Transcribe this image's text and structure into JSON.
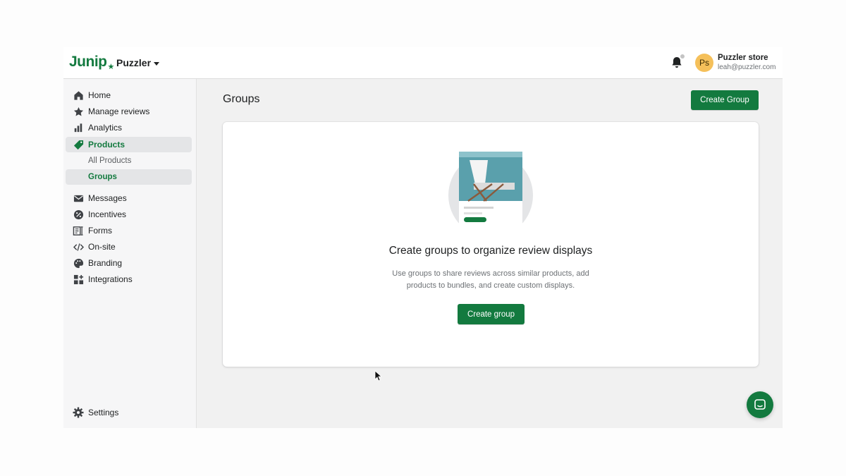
{
  "header": {
    "logo": "Junip",
    "store": "Puzzler",
    "account": {
      "initials": "Ps",
      "name": "Puzzler store",
      "email": "leah@puzzler.com"
    }
  },
  "sidebar": {
    "items": [
      {
        "label": "Home",
        "icon": "home-icon"
      },
      {
        "label": "Manage reviews",
        "icon": "star-icon"
      },
      {
        "label": "Analytics",
        "icon": "bar-chart-icon"
      },
      {
        "label": "Products",
        "icon": "tag-icon",
        "active": true
      },
      {
        "label": "All Products"
      },
      {
        "label": "Groups",
        "active": true
      },
      {
        "label": "Messages",
        "icon": "envelope-icon"
      },
      {
        "label": "Incentives",
        "icon": "discount-icon"
      },
      {
        "label": "Forms",
        "icon": "form-icon"
      },
      {
        "label": "On-site",
        "icon": "code-icon"
      },
      {
        "label": "Branding",
        "icon": "palette-icon"
      },
      {
        "label": "Integrations",
        "icon": "apps-icon"
      }
    ],
    "settings": {
      "label": "Settings",
      "icon": "gear-icon"
    }
  },
  "main": {
    "title": "Groups",
    "create_button": "Create Group",
    "empty_state": {
      "heading": "Create groups to organize review displays",
      "description": "Use groups to share reviews across similar products, add products to bundles, and create custom displays.",
      "button": "Create group"
    }
  },
  "colors": {
    "brand": "#137a3f",
    "avatar": "#f5c05a",
    "background": "#f1f1f1"
  }
}
